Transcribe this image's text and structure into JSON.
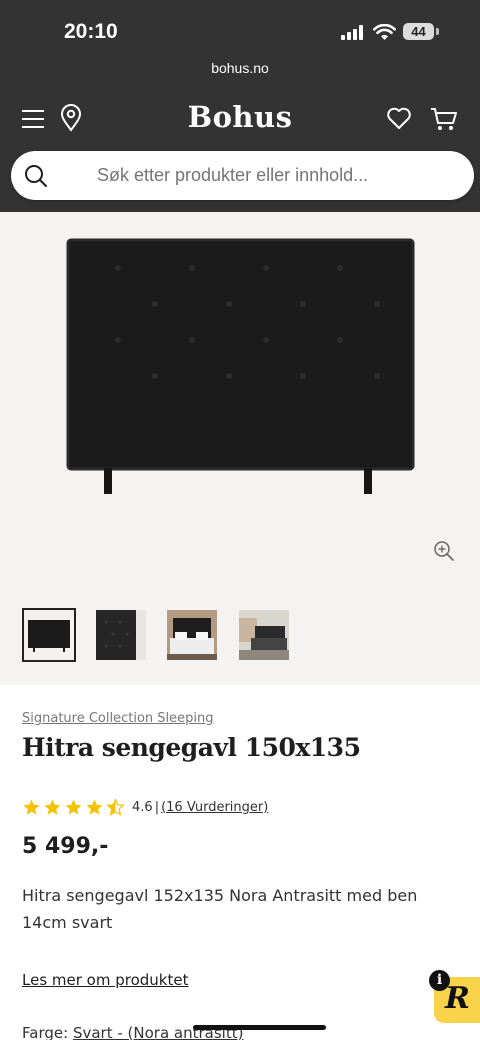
{
  "status_bar": {
    "time": "20:10",
    "battery": "44"
  },
  "browser": {
    "url": "bohus.no"
  },
  "header": {
    "logo": "Bohus",
    "icons": [
      "menu-icon",
      "location-pin-icon",
      "heart-icon",
      "cart-icon"
    ]
  },
  "search": {
    "placeholder": "Søk etter produkter eller innhold..."
  },
  "gallery": {
    "thumbnails": [
      "headboard-front",
      "headboard-side",
      "bedroom-scene-1",
      "bedroom-scene-2"
    ],
    "selected_index": 0
  },
  "product": {
    "brand": "Signature Collection Sleeping",
    "title": "Hitra sengegavl 150x135",
    "rating": {
      "value": "4.6",
      "stars": 4.6,
      "separator": "|",
      "reviews_link": "(16 Vurderinger)"
    },
    "price": "5 499,-",
    "description": "Hitra sengegavl 152x135 Nora Antrasitt med ben 14cm svart",
    "read_more": "Les mer om produktet",
    "color_label": "Farge:",
    "color_value": "Svart - (Nora antrasitt)"
  },
  "widget": {
    "info": "i",
    "logo_letter": "R"
  },
  "colors": {
    "header_bg": "#333333",
    "gallery_bg": "#f5f3f1",
    "star": "#f6c200",
    "widget": "#f9d34a"
  }
}
